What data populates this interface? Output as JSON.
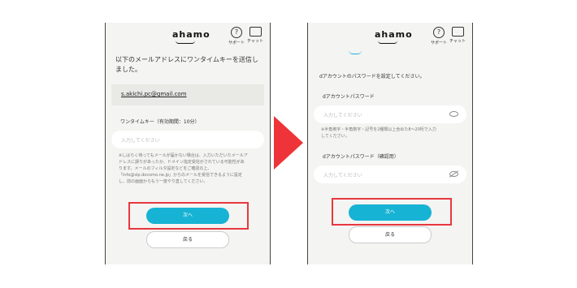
{
  "brand": "ahamo",
  "header": {
    "support_label": "サポート",
    "chat_label": "チャット",
    "support_glyph": "?"
  },
  "left": {
    "intro": "以下のメールアドレスにワンタイムキーを送信しました。",
    "email": "s.akichi.pc@gmail.com",
    "otp_label": "ワンタイムキー（有効期間：10分）",
    "otp_placeholder": "入力してください",
    "note_lines": [
      "※しばらく待ってもメールが届かない場合は、入力いただいたメールア",
      "ドレスに誤りがあったか、ドメイン指定受信がされている可能性があ",
      "ります。メールのフィルタ設定などをご確認の上、",
      "「info@slp.docomo.ne.jp」からのメールを受信できるように設定",
      "し、前の画面からもう一度やり直してください。"
    ],
    "next_button": "次へ",
    "back_button": "戻る"
  },
  "right": {
    "heading": "dアカウントのパスワードを設定してください。",
    "password_label": "dアカウントパスワード",
    "password_placeholder": "入力してください",
    "password_note_lines": [
      "※半角英字・半角数字・記号を2種類以上含めた8〜20桁で入力",
      "してください。"
    ],
    "confirm_label": "dアカウントパスワード（確認用）",
    "confirm_placeholder": "入力してください",
    "next_button": "次へ",
    "back_button": "戻る"
  },
  "colors": {
    "accent": "#16b3d4",
    "highlight": "#e8373f",
    "arrow": "#ee3439"
  }
}
